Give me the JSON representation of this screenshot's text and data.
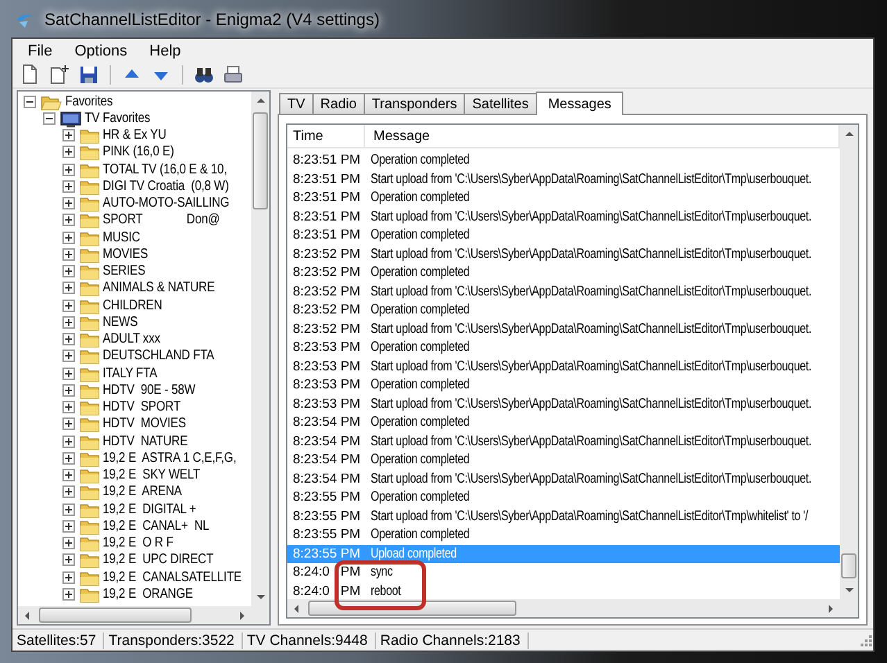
{
  "window": {
    "title": "SatChannelListEditor - Enigma2 (V4 settings)"
  },
  "menu": [
    "File",
    "Options",
    "Help"
  ],
  "tree": [
    {
      "label": "Favorites",
      "kind": "folder",
      "expanded": true,
      "children": [
        {
          "label": "TV Favorites",
          "kind": "tv",
          "expanded": true,
          "children": [
            {
              "label": "HR & Ex YU",
              "kind": "folder",
              "expanded": false
            },
            {
              "label": "PINK (16,0 E)",
              "kind": "folder",
              "expanded": false
            },
            {
              "label": "TOTAL TV (16,0 E & 10,",
              "kind": "folder",
              "expanded": false
            },
            {
              "label": "DIGI TV Croatia  (0,8 W)",
              "kind": "folder",
              "expanded": false
            },
            {
              "label": "AUTO-MOTO-SAILLING",
              "kind": "folder",
              "expanded": false
            },
            {
              "label": "SPORT              Don@",
              "kind": "folder",
              "expanded": false
            },
            {
              "label": "MUSIC",
              "kind": "folder",
              "expanded": false
            },
            {
              "label": "MOVIES",
              "kind": "folder",
              "expanded": false
            },
            {
              "label": "SERIES",
              "kind": "folder",
              "expanded": false
            },
            {
              "label": "ANIMALS & NATURE",
              "kind": "folder",
              "expanded": false
            },
            {
              "label": "CHILDREN",
              "kind": "folder",
              "expanded": false
            },
            {
              "label": "NEWS",
              "kind": "folder",
              "expanded": false
            },
            {
              "label": "ADULT xxx",
              "kind": "folder",
              "expanded": false
            },
            {
              "label": "DEUTSCHLAND FTA",
              "kind": "folder",
              "expanded": false
            },
            {
              "label": "ITALY FTA",
              "kind": "folder",
              "expanded": false
            },
            {
              "label": "HDTV  90E - 58W",
              "kind": "folder",
              "expanded": false
            },
            {
              "label": "HDTV  SPORT",
              "kind": "folder",
              "expanded": false
            },
            {
              "label": "HDTV  MOVIES",
              "kind": "folder",
              "expanded": false
            },
            {
              "label": "HDTV  NATURE",
              "kind": "folder",
              "expanded": false
            },
            {
              "label": "19,2 E  ASTRA 1 C,E,F,G,",
              "kind": "folder",
              "expanded": false
            },
            {
              "label": "19,2 E  SKY WELT",
              "kind": "folder",
              "expanded": false
            },
            {
              "label": "19,2 E  ARENA",
              "kind": "folder",
              "expanded": false
            },
            {
              "label": "19,2 E  DIGITAL +",
              "kind": "folder",
              "expanded": false
            },
            {
              "label": "19,2 E  CANAL+  NL",
              "kind": "folder",
              "expanded": false
            },
            {
              "label": "19,2 E  O R F",
              "kind": "folder",
              "expanded": false
            },
            {
              "label": "19,2 E  UPC DIRECT",
              "kind": "folder",
              "expanded": false
            },
            {
              "label": "19,2 E  CANALSATELLITE",
              "kind": "folder",
              "expanded": false
            },
            {
              "label": "19,2 E  ORANGE",
              "kind": "folder",
              "expanded": false
            }
          ]
        }
      ]
    }
  ],
  "tabs": [
    {
      "label": "TV",
      "selected": false
    },
    {
      "label": "Radio",
      "selected": false
    },
    {
      "label": "Transponders",
      "selected": false
    },
    {
      "label": "Satellites",
      "selected": false
    },
    {
      "label": "Messages",
      "selected": true
    }
  ],
  "messages": {
    "columns": [
      "Time",
      "Message"
    ],
    "rows": [
      {
        "time": "8:23:51 PM",
        "message": "Operation completed",
        "selected": false
      },
      {
        "time": "8:23:51 PM",
        "message": "Start upload from 'C:\\Users\\Syber\\AppData\\Roaming\\SatChannelListEditor\\Tmp\\userbouquet.",
        "selected": false
      },
      {
        "time": "8:23:51 PM",
        "message": "Operation completed",
        "selected": false
      },
      {
        "time": "8:23:51 PM",
        "message": "Start upload from 'C:\\Users\\Syber\\AppData\\Roaming\\SatChannelListEditor\\Tmp\\userbouquet.",
        "selected": false
      },
      {
        "time": "8:23:51 PM",
        "message": "Operation completed",
        "selected": false
      },
      {
        "time": "8:23:52 PM",
        "message": "Start upload from 'C:\\Users\\Syber\\AppData\\Roaming\\SatChannelListEditor\\Tmp\\userbouquet.",
        "selected": false
      },
      {
        "time": "8:23:52 PM",
        "message": "Operation completed",
        "selected": false
      },
      {
        "time": "8:23:52 PM",
        "message": "Start upload from 'C:\\Users\\Syber\\AppData\\Roaming\\SatChannelListEditor\\Tmp\\userbouquet.",
        "selected": false
      },
      {
        "time": "8:23:52 PM",
        "message": "Operation completed",
        "selected": false
      },
      {
        "time": "8:23:52 PM",
        "message": "Start upload from 'C:\\Users\\Syber\\AppData\\Roaming\\SatChannelListEditor\\Tmp\\userbouquet.",
        "selected": false
      },
      {
        "time": "8:23:53 PM",
        "message": "Operation completed",
        "selected": false
      },
      {
        "time": "8:23:53 PM",
        "message": "Start upload from 'C:\\Users\\Syber\\AppData\\Roaming\\SatChannelListEditor\\Tmp\\userbouquet.",
        "selected": false
      },
      {
        "time": "8:23:53 PM",
        "message": "Operation completed",
        "selected": false
      },
      {
        "time": "8:23:53 PM",
        "message": "Start upload from 'C:\\Users\\Syber\\AppData\\Roaming\\SatChannelListEditor\\Tmp\\userbouquet.",
        "selected": false
      },
      {
        "time": "8:23:54 PM",
        "message": "Operation completed",
        "selected": false
      },
      {
        "time": "8:23:54 PM",
        "message": "Start upload from 'C:\\Users\\Syber\\AppData\\Roaming\\SatChannelListEditor\\Tmp\\userbouquet.",
        "selected": false
      },
      {
        "time": "8:23:54 PM",
        "message": "Operation completed",
        "selected": false
      },
      {
        "time": "8:23:54 PM",
        "message": "Start upload from 'C:\\Users\\Syber\\AppData\\Roaming\\SatChannelListEditor\\Tmp\\userbouquet.",
        "selected": false
      },
      {
        "time": "8:23:55 PM",
        "message": "Operation completed",
        "selected": false
      },
      {
        "time": "8:23:55 PM",
        "message": "Start upload from 'C:\\Users\\Syber\\AppData\\Roaming\\SatChannelListEditor\\Tmp\\whitelist' to '/",
        "selected": false
      },
      {
        "time": "8:23:55 PM",
        "message": "Operation completed",
        "selected": false
      },
      {
        "time": "8:23:55 PM",
        "message": "Upload completed",
        "selected": true
      },
      {
        "time": "8:24:0",
        "time_tail": "PM",
        "message": "sync",
        "selected": false
      },
      {
        "time": "8:24:0",
        "time_tail": "PM",
        "message": "reboot",
        "selected": false
      }
    ]
  },
  "status_bar": [
    "Satellites:57",
    "Transponders:3522",
    "TV Channels:9448",
    "Radio Channels:2183"
  ]
}
